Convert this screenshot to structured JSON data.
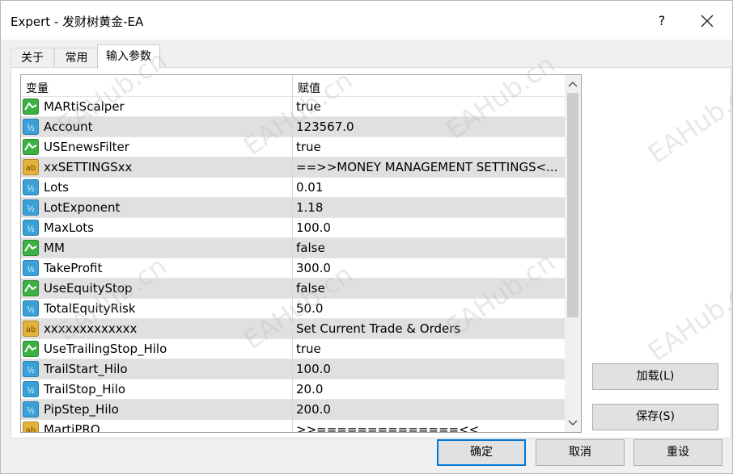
{
  "window": {
    "title": "Expert - 发财树黄金-EA",
    "help_label": "?"
  },
  "tabs": [
    {
      "label": "关于",
      "active": false
    },
    {
      "label": "常用",
      "active": false
    },
    {
      "label": "输入参数",
      "active": true
    }
  ],
  "grid": {
    "columns": [
      "变量",
      "赋值"
    ],
    "rows": [
      {
        "icon": "bool-icon",
        "name": "MARtiScalper",
        "value": "true"
      },
      {
        "icon": "number-icon",
        "name": "Account",
        "value": "123567.0"
      },
      {
        "icon": "bool-icon",
        "name": "USEnewsFilter",
        "value": "true"
      },
      {
        "icon": "string-icon",
        "name": "xxSETTINGSxx",
        "value": "==>>MONEY MANAGEMENT SETTINGS<..."
      },
      {
        "icon": "number-icon",
        "name": "Lots",
        "value": "0.01"
      },
      {
        "icon": "number-icon",
        "name": "LotExponent",
        "value": "1.18"
      },
      {
        "icon": "number-icon",
        "name": "MaxLots",
        "value": "100.0"
      },
      {
        "icon": "bool-icon",
        "name": "MM",
        "value": "false"
      },
      {
        "icon": "number-icon",
        "name": "TakeProfit",
        "value": "300.0"
      },
      {
        "icon": "bool-icon",
        "name": "UseEquityStop",
        "value": "false"
      },
      {
        "icon": "number-icon",
        "name": "TotalEquityRisk",
        "value": "50.0"
      },
      {
        "icon": "string-icon",
        "name": "xxxxxxxxxxxxx",
        "value": "Set Current Trade & Orders"
      },
      {
        "icon": "bool-icon",
        "name": "UseTrailingStop_Hilo",
        "value": "true"
      },
      {
        "icon": "number-icon",
        "name": "TrailStart_Hilo",
        "value": "100.0"
      },
      {
        "icon": "number-icon",
        "name": "TrailStop_Hilo",
        "value": "20.0"
      },
      {
        "icon": "number-icon",
        "name": "PipStep_Hilo",
        "value": "200.0"
      },
      {
        "icon": "string-icon",
        "name": "MartiPRO",
        "value": ">>==============<<"
      }
    ]
  },
  "buttons": {
    "load": "加载(L)",
    "save": "保存(S)",
    "ok": "确定",
    "cancel": "取消",
    "reset": "重设"
  },
  "watermark": "EAHub.cn",
  "colors": {
    "bool_icon": "#3cb043",
    "number_icon": "#3aa0d8",
    "string_icon": "#d4a017",
    "focus": "#0078d7"
  }
}
